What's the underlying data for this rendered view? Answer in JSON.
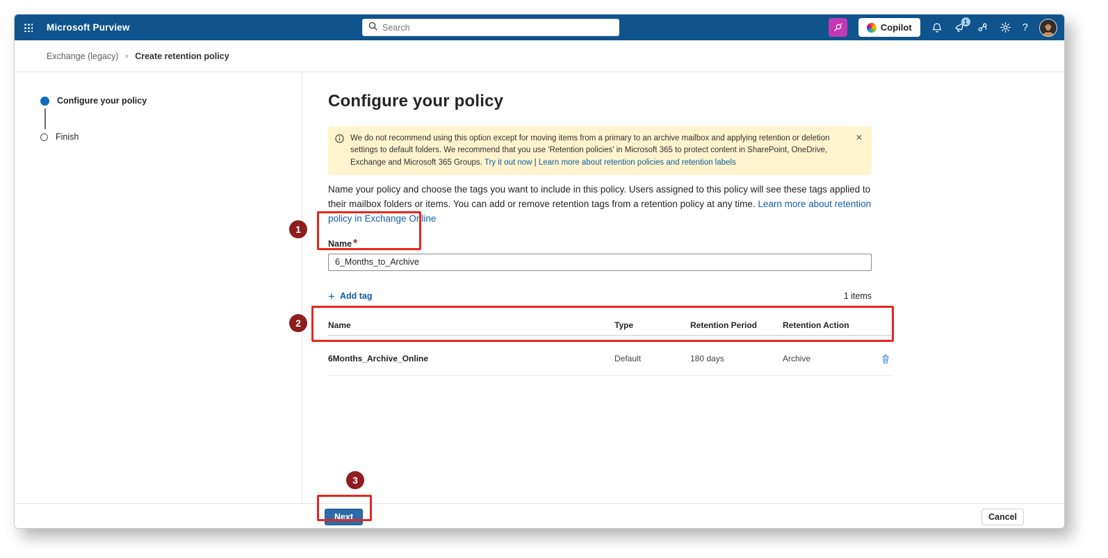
{
  "topbar": {
    "app_title": "Microsoft Purview",
    "search_placeholder": "Search",
    "copilot_label": "Copilot",
    "alerts_badge": "1",
    "help_glyph": "?"
  },
  "breadcrumb": {
    "parent": "Exchange (legacy)",
    "separator": "›",
    "current": "Create retention policy"
  },
  "stepper": {
    "step1": "Configure your policy",
    "step2": "Finish"
  },
  "main": {
    "title": "Configure your policy",
    "banner": {
      "text": "We do not recommend using this option except for moving items from a primary to an archive mailbox and applying retention or deletion settings to default folders. We recommend that you use 'Retention policies' in Microsoft 365 to protect content in SharePoint, OneDrive, Exchange and Microsoft 365 Groups.",
      "link_try": "Try it out now",
      "pipe": "|",
      "link_learn": "Learn more about retention policies and retention labels",
      "close_glyph": "✕"
    },
    "intro": {
      "text": "Name your policy and choose the tags you want to include in this policy. Users assigned to this policy will see these tags applied to their mailbox folders or items. You can add or remove retention tags from a retention policy at any time.",
      "link": "Learn more about retention policy in Exchange Online"
    },
    "name_field": {
      "label": "Name",
      "required_marker": "*",
      "value": "6_Months_to_Archive"
    },
    "add_tag": {
      "plus_glyph": "+",
      "label": "Add tag"
    },
    "items_count": "1 items",
    "table": {
      "columns": [
        "Name",
        "Type",
        "Retention Period",
        "Retention Action"
      ],
      "rows": [
        {
          "name": "6Months_Archive_Online",
          "type": "Default",
          "retention_period": "180 days",
          "retention_action": "Archive"
        }
      ]
    }
  },
  "footer": {
    "next_label": "Next",
    "cancel_label": "Cancel"
  },
  "annotations": {
    "step1": "1",
    "step2": "2",
    "step3": "3"
  },
  "colors": {
    "header_blue": "#0F548C",
    "magenta_button": "#C239B3",
    "link_blue": "#115EA3",
    "banner_yellow": "#FFF4CE",
    "annotation_circle": "#8E1D1E",
    "annotation_box": "#E8251D",
    "primary_button": "#2B6CA8",
    "step_active_blue": "#0F6CBD",
    "trash_icon_blue": "#4F90D1"
  }
}
